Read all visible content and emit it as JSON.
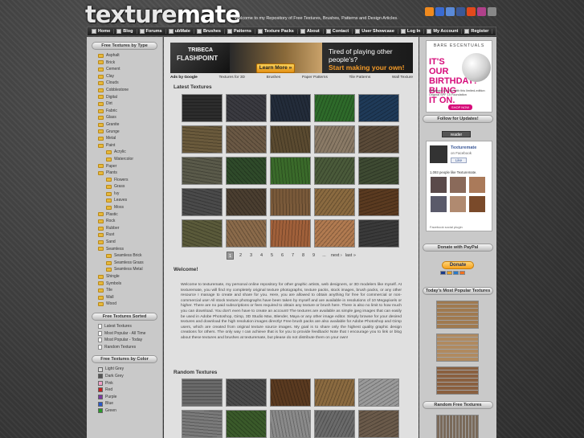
{
  "header": {
    "logo_prefix": "texture",
    "logo_suffix": "mate",
    "tagline": "Welcome to my Repository of Free Textures, Brushes, Patterns and Design Articles."
  },
  "social": [
    {
      "name": "rss-icon",
      "color": "#f08a1e"
    },
    {
      "name": "delicious-icon",
      "color": "#3a6bd1"
    },
    {
      "name": "digg-icon",
      "color": "#5a8ad8"
    },
    {
      "name": "facebook-icon",
      "color": "#3b5998"
    },
    {
      "name": "stumble-icon",
      "color": "#e34a1c"
    },
    {
      "name": "flickr-icon",
      "color": "#b0408a"
    },
    {
      "name": "email-icon",
      "color": "#888888"
    }
  ],
  "nav": [
    "Home",
    "Blog",
    "Forums",
    "ubMate",
    "Brushes",
    "Patterns",
    "Texture Packs",
    "About",
    "Contact",
    "User Showcase",
    "Log In",
    "My Account",
    "Register"
  ],
  "left": {
    "types_title": "Free Textures by Type",
    "types": [
      {
        "label": "Asphalt",
        "sub": false
      },
      {
        "label": "Brick",
        "sub": false
      },
      {
        "label": "Cement",
        "sub": false
      },
      {
        "label": "Clay",
        "sub": false
      },
      {
        "label": "Clouds",
        "sub": false
      },
      {
        "label": "Cobblestone",
        "sub": false
      },
      {
        "label": "Digital",
        "sub": false
      },
      {
        "label": "Dirt",
        "sub": false
      },
      {
        "label": "Fabric",
        "sub": false
      },
      {
        "label": "Glass",
        "sub": false
      },
      {
        "label": "Granite",
        "sub": false
      },
      {
        "label": "Grunge",
        "sub": false
      },
      {
        "label": "Metal",
        "sub": false
      },
      {
        "label": "Paint",
        "sub": false
      },
      {
        "label": "Acrylic",
        "sub": true
      },
      {
        "label": "Watercolor",
        "sub": true
      },
      {
        "label": "Paper",
        "sub": false
      },
      {
        "label": "Plants",
        "sub": false
      },
      {
        "label": "Flowers",
        "sub": true
      },
      {
        "label": "Grass",
        "sub": true
      },
      {
        "label": "Ivy",
        "sub": true
      },
      {
        "label": "Leaves",
        "sub": true
      },
      {
        "label": "Moss",
        "sub": true
      },
      {
        "label": "Plastic",
        "sub": false
      },
      {
        "label": "Rock",
        "sub": false
      },
      {
        "label": "Rubber",
        "sub": false
      },
      {
        "label": "Rust",
        "sub": false
      },
      {
        "label": "Sand",
        "sub": false
      },
      {
        "label": "Seamless",
        "sub": false
      },
      {
        "label": "Seamless Brick",
        "sub": true
      },
      {
        "label": "Seamless Grass",
        "sub": true
      },
      {
        "label": "Seamless Metal",
        "sub": true
      },
      {
        "label": "Shingle",
        "sub": false
      },
      {
        "label": "Symbols",
        "sub": false
      },
      {
        "label": "Tile",
        "sub": false
      },
      {
        "label": "Wall",
        "sub": false
      },
      {
        "label": "Wood",
        "sub": false
      }
    ],
    "sorted_title": "Free Textures Sorted",
    "sorted": [
      "Latest Textures",
      "Most Popular - All Time",
      "Most Popular - Today",
      "Random Textures"
    ],
    "color_title": "Free Textures by Color",
    "colors": [
      {
        "label": "Light Grey",
        "color": "#d8d8d8"
      },
      {
        "label": "Dark Grey",
        "color": "#555555"
      },
      {
        "label": "Pink",
        "color": "#f0a0c8"
      },
      {
        "label": "Red",
        "color": "#c82020"
      },
      {
        "label": "Purple",
        "color": "#7a3aa0"
      },
      {
        "label": "Blue",
        "color": "#2a58c8"
      },
      {
        "label": "Green",
        "color": "#2a9a2a"
      }
    ]
  },
  "ad_top": {
    "brand1": "TRIBECA",
    "brand2": "FLASHPOINT",
    "headline_1": "Tired of playing other people's?",
    "headline_2": "Start making your own!",
    "cta": "Learn More »"
  },
  "ad_links": [
    "Ads by Google",
    "Textures for 3D",
    "Brushes",
    "Paper Patterns",
    "Tile Patterns",
    "Wall Texture"
  ],
  "latest": {
    "title": "Latest Textures",
    "tiles": [
      "#2c2c2c",
      "#3a3a40",
      "#232c3a",
      "#2e6a2a",
      "#1f3a58",
      "#6a5a3c",
      "#6a5844",
      "#5a4a30",
      "#8a7a66",
      "#5a4a38",
      "#5a5a4a",
      "#2f4a2a",
      "#3a6a2a",
      "#4a5a3a",
      "#3e4a32",
      "#4a4a4a",
      "#4a3e30",
      "#7a5a3a",
      "#8a6a40",
      "#5a3a20",
      "#5a5a3a",
      "#8a6a4a",
      "#a0603a",
      "#b07a50",
      "#3a3a3a"
    ]
  },
  "pager": [
    "1",
    "2",
    "3",
    "4",
    "5",
    "6",
    "7",
    "8",
    "9",
    "...",
    "next ›",
    "last »"
  ],
  "welcome": {
    "title": "Welcome!",
    "body": "Welcome to texturemate, my personal online repository for other graphic artists, web designers, or 3D modelers like myself. At texturemate, you will find my completely original texture photographs, texture packs, stock images, brush packs, or any other resource I manage to create and share for you. Here, you are allowed to obtain anything for free for commercial or non-commercial use! All stock texture photographs have been taken by myself and are available in resolutions of 10 Megapixels or higher. There are no paid subscriptions or fees required to obtain any texture or brush here. There is also no limit to how much you can download. You don't even have to create an account! The textures are available as simple jpeg images that can easily be used in Adobe Photoshop, Gimp, 3D Studio Max, Blender, Maya or any other image editor. Simply browse for your desired textures and download the high resolution images directly! Free brush packs are also available for Adobe Photoshop and Gimp users, which are created from original texture source images. My goal is to share only the highest quality graphic design creations for others. The only way I can achieve that is for you to provide feedback! Note that I encourage you to link or blog about these textures and brushes at texturemate, but please do not distribute them on your own!"
  },
  "random": {
    "title": "Random Textures",
    "tiles": [
      "#6a6a6a",
      "#4a4a4a",
      "#5a3a20",
      "#8a6a40",
      "#9a9a9a",
      "#7a7a7a",
      "#3a5a2a",
      "#8a8a8a",
      "#6a6a6a",
      "#6a5a4a"
    ]
  },
  "right": {
    "ad": {
      "brand": "BARE ESCENTUALS",
      "headline": "IT'S OUR BIRTHDAY! BLING IT ON.",
      "small": "Celebrate our 2nd with this limited-edition Original SPF 15 Foundation",
      "cta": "SHOP NOW"
    },
    "follow_title": "Follow for Updates!",
    "feed": "reader",
    "fb": {
      "page_name": "Texturemate",
      "page_sub": "on Facebook",
      "like": "Like",
      "count": "1,093 people like Texturemate.",
      "faces": [
        "#5a4a4a",
        "#8a6a5a",
        "#aa7a5a",
        "#5a5a6a",
        "#b08a70",
        "#7a4a2a"
      ],
      "plugin": "Facebook social plugin"
    },
    "donate_title": "Donate with PayPal",
    "donate": "Donate",
    "popular_title": "Today's Most Popular Textures",
    "popular": [
      "#a07a50",
      "#b08a60",
      "#8a6040"
    ],
    "random_title": "Random Free Textures",
    "random_tile": "#7a6a5a"
  }
}
